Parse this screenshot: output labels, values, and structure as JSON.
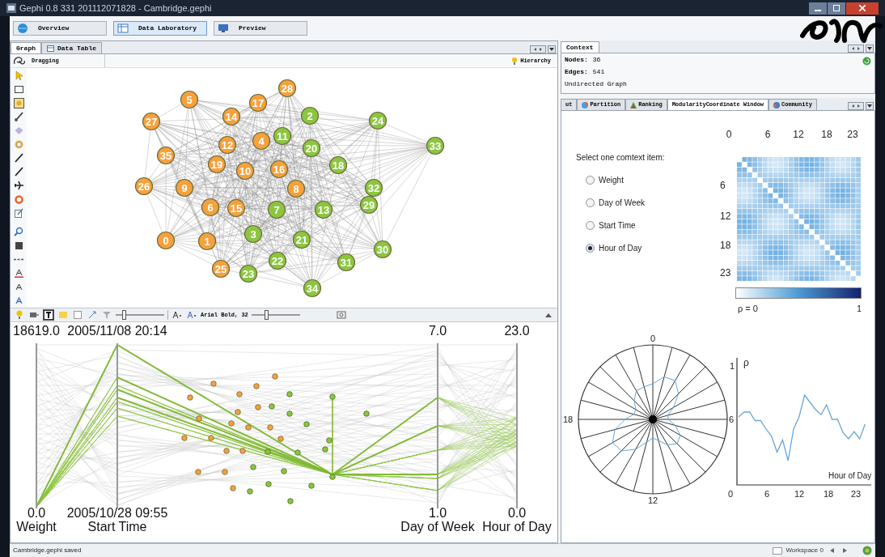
{
  "window": {
    "title": "Gephi 0.8 331 201112071828 - Cambridge.gephi"
  },
  "perspectives": [
    {
      "label": "Overview",
      "selected": false
    },
    {
      "label": "Data Laboratory",
      "selected": true
    },
    {
      "label": "Preview",
      "selected": false
    }
  ],
  "graph_panel": {
    "tabs": [
      {
        "label": "Graph",
        "selected": true
      },
      {
        "label": "Data Table",
        "selected": false
      }
    ],
    "tool_label": "Dragging",
    "hierarchy_label": "Hierarchy",
    "nodes": [
      {
        "label": "28",
        "color": "#f7a13b"
      },
      {
        "label": "5",
        "color": "#f7a13b"
      },
      {
        "label": "17",
        "color": "#f7a13b"
      },
      {
        "label": "27",
        "color": "#f7a13b"
      },
      {
        "label": "14",
        "color": "#f7a13b"
      },
      {
        "label": "2",
        "color": "#8cc63f"
      },
      {
        "label": "24",
        "color": "#8cc63f"
      },
      {
        "label": "12",
        "color": "#f7a13b"
      },
      {
        "label": "4",
        "color": "#f7a13b"
      },
      {
        "label": "11",
        "color": "#8cc63f"
      },
      {
        "label": "20",
        "color": "#8cc63f"
      },
      {
        "label": "33",
        "color": "#8cc63f"
      },
      {
        "label": "35",
        "color": "#f7a13b"
      },
      {
        "label": "19",
        "color": "#f7a13b"
      },
      {
        "label": "10",
        "color": "#f7a13b"
      },
      {
        "label": "16",
        "color": "#f7a13b"
      },
      {
        "label": "18",
        "color": "#8cc63f"
      },
      {
        "label": "26",
        "color": "#f7a13b"
      },
      {
        "label": "9",
        "color": "#f7a13b"
      },
      {
        "label": "8",
        "color": "#f7a13b"
      },
      {
        "label": "32",
        "color": "#8cc63f"
      },
      {
        "label": "6",
        "color": "#f7a13b"
      },
      {
        "label": "15",
        "color": "#f7a13b"
      },
      {
        "label": "7",
        "color": "#8cc63f"
      },
      {
        "label": "13",
        "color": "#8cc63f"
      },
      {
        "label": "29",
        "color": "#8cc63f"
      },
      {
        "label": "0",
        "color": "#f7a13b"
      },
      {
        "label": "1",
        "color": "#f7a13b"
      },
      {
        "label": "3",
        "color": "#8cc63f"
      },
      {
        "label": "21",
        "color": "#8cc63f"
      },
      {
        "label": "30",
        "color": "#8cc63f"
      },
      {
        "label": "22",
        "color": "#8cc63f"
      },
      {
        "label": "31",
        "color": "#8cc63f"
      },
      {
        "label": "25",
        "color": "#f7a13b"
      },
      {
        "label": "23",
        "color": "#8cc63f"
      },
      {
        "label": "34",
        "color": "#8cc63f"
      }
    ]
  },
  "bottom_toolbar": {
    "sliders": [
      {
        "level": 0.15
      },
      {
        "level": 0.3
      }
    ],
    "font_label": "Arial Bold, 32"
  },
  "parallel_coordinates": {
    "axes": [
      {
        "name": "Weight",
        "max": "18619.0",
        "min": "0.0"
      },
      {
        "name": "Start Time",
        "max": "2005/11/08 20:14",
        "min": "2005/10/28 09:55"
      },
      {
        "name": "Day of Week",
        "max": "7.0",
        "min": "1.0"
      },
      {
        "name": "Hour of Day",
        "max": "23.0",
        "min": "0.0"
      }
    ]
  },
  "context": {
    "tab": "Context",
    "rows": [
      {
        "label": "Nodes:",
        "value": "36"
      },
      {
        "label": "Edges:",
        "value": "541"
      }
    ],
    "graph_type": "Undirected Graph"
  },
  "right_tabs": [
    {
      "label": "ut",
      "selected": false
    },
    {
      "label": "Partition",
      "selected": false
    },
    {
      "label": "Ranking",
      "selected": false
    },
    {
      "label": "ModularityCoordinate Window",
      "selected": true
    },
    {
      "label": "Community",
      "selected": false
    }
  ],
  "context_items": {
    "prompt": "Select one comtext item:",
    "options": [
      {
        "label": "Weight",
        "selected": false
      },
      {
        "label": "Day of Week",
        "selected": false
      },
      {
        "label": "Start Time",
        "selected": false
      },
      {
        "label": "Hour of Day",
        "selected": true
      }
    ]
  },
  "heatmap": {
    "top_ticks": [
      "0",
      "6",
      "12",
      "18",
      "23"
    ],
    "left_ticks": [
      "6",
      "12",
      "18",
      "23"
    ],
    "legend_min": "ρ = 0",
    "legend_max": "1"
  },
  "polar_plot": {
    "labels": [
      "0",
      "6",
      "12",
      "18"
    ]
  },
  "line_plot": {
    "y_label": "ρ",
    "y_tick": "1",
    "x_label": "Hour of Day",
    "x_ticks": [
      "0",
      "6",
      "12",
      "18",
      "23"
    ]
  },
  "status_bar": {
    "message": "Cambridge.gephi saved",
    "workspace": "Workspace 0"
  }
}
